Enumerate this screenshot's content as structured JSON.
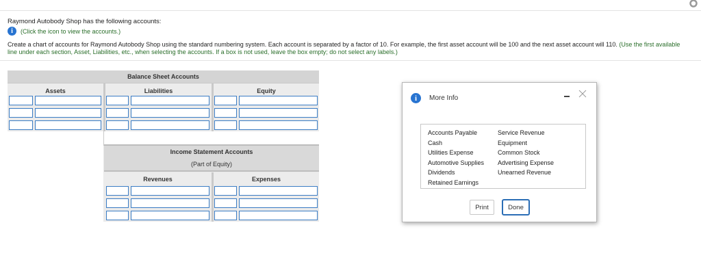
{
  "intro_text": "Raymond Autobody Shop has the following accounts:",
  "info_link": "(Click the icon to view the accounts.)",
  "instructions": {
    "main": "Create a chart of accounts for Raymond Autobody Shop using the standard numbering system. Each account is separated by a factor of 10. For example, the first asset account will be 100 and the next asset account will 110. ",
    "note": "(Use the first available line under each section, Asset, Liabilities, etc., when selecting the accounts. If a box is not used, leave the box empty; do not select any labels.)"
  },
  "worksheet": {
    "balance_sheet_title": "Balance Sheet Accounts",
    "col_assets": "Assets",
    "col_liabilities": "Liabilities",
    "col_equity": "Equity",
    "income_statement_title": "Income Statement Accounts",
    "income_statement_sub": "(Part of Equity)",
    "col_revenues": "Revenues",
    "col_expenses": "Expenses"
  },
  "dialog": {
    "title": "More Info",
    "accounts_col1": [
      "Accounts Payable",
      "Cash",
      "Utilities Expense",
      "Automotive Supplies",
      "Dividends",
      "Retained Earnings"
    ],
    "accounts_col2": [
      "Service Revenue",
      "Equipment",
      "Common Stock",
      "Advertising Expense",
      "Unearned Revenue"
    ],
    "print_label": "Print",
    "done_label": "Done"
  },
  "colors": {
    "accent": "#2874d1",
    "input_border": "#3a7cc4",
    "note_green": "#2a6e2a"
  }
}
